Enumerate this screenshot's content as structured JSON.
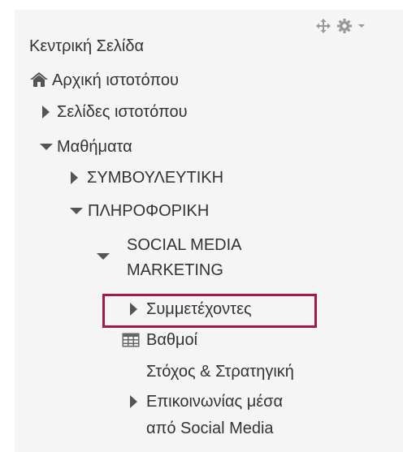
{
  "colors": {
    "background": "#f5f5f5",
    "text": "#333333",
    "icon": "#555555",
    "highlight_border": "#a3194a"
  },
  "controls": {
    "move_icon": "move-icon",
    "settings_icon": "gear-icon",
    "caret_icon": "caret-down-icon"
  },
  "nav": {
    "home_label": "Κεντρική Σελίδα",
    "site_home_label": "Αρχική ιστοτόπου",
    "site_home_icon": "home-icon",
    "site_pages_label": "Σελίδες ιστοτόπου",
    "courses_label": "Μαθήματα",
    "category_1_label": "ΣΥΜΒΟΥΛΕΥΤΙΚΗ",
    "category_2_label": "ΠΛΗΡΟΦΟΡΙΚΗ",
    "course_label_line1": "SOCIAL MEDIA",
    "course_label_line2": "MARKETING",
    "participants_label": "Συμμετέχοντες",
    "grades_label": "Βαθμοί",
    "grades_icon": "grades-table-icon",
    "section_1_label": "Στόχος & Στρατηγική",
    "section_2_line1": "Επικοινωνίας μέσα",
    "section_2_line2": "από Social Media"
  }
}
